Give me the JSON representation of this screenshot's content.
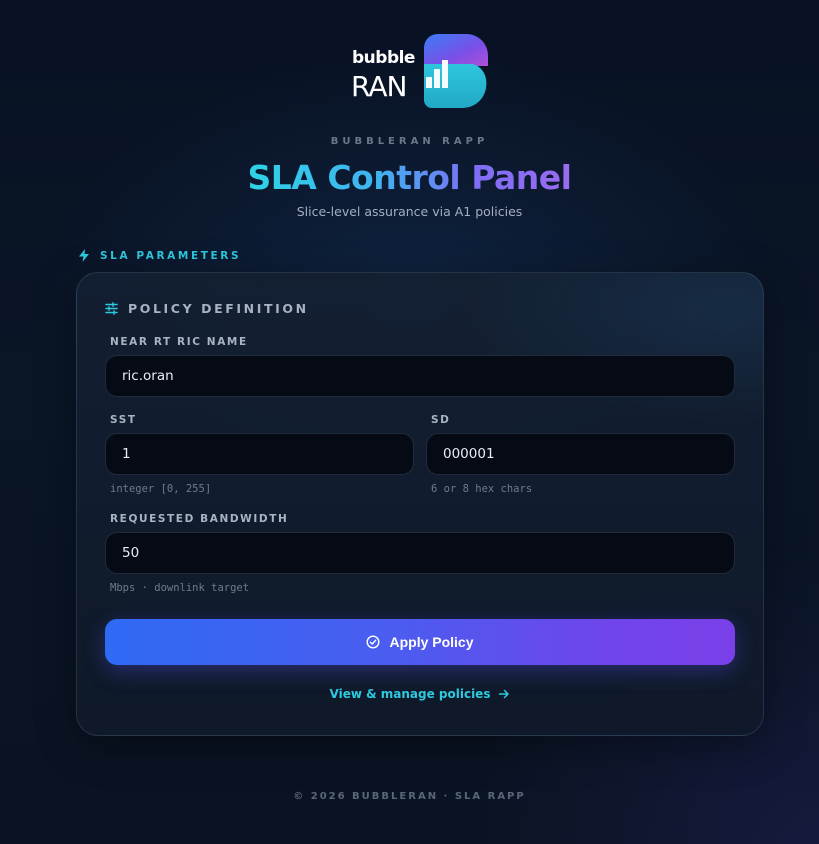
{
  "brand": {
    "logo_word_top": "bubble",
    "logo_word_bottom": "RAN"
  },
  "header": {
    "eyebrow": "BUBBLERAN RAPP",
    "title": "SLA Control Panel",
    "subtitle": "Slice-level assurance via A1 policies"
  },
  "section": {
    "label": "SLA PARAMETERS",
    "icon": "lightning-icon"
  },
  "card": {
    "title": "POLICY DEFINITION",
    "icon": "sliders-icon",
    "fields": {
      "ric_name": {
        "label": "NEAR RT RIC NAME",
        "value": "ric.oran"
      },
      "sst": {
        "label": "SST",
        "value": "1",
        "hint": "integer [0, 255]"
      },
      "sd": {
        "label": "SD",
        "value": "000001",
        "hint": "6 or 8 hex chars"
      },
      "bandwidth": {
        "label": "REQUESTED BANDWIDTH",
        "value": "50",
        "hint": "Mbps · downlink target"
      }
    },
    "apply_button": {
      "label": "Apply Policy",
      "icon": "check-circle-icon"
    },
    "manage_link": {
      "label": "View & manage policies",
      "icon": "arrow-right-icon"
    }
  },
  "footer": {
    "text": "© 2026 BUBBLERAN · SLA RAPP"
  },
  "colors": {
    "accent_cyan": "#2ec9df",
    "accent_purple": "#7a3fe8",
    "accent_blue": "#2f6af5",
    "background": "#0a1526"
  }
}
